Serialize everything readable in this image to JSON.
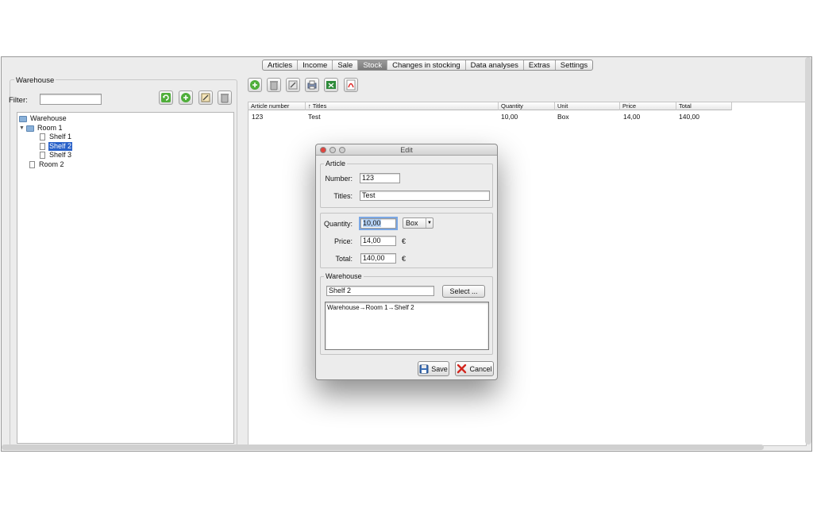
{
  "tabs": [
    {
      "label": "Articles",
      "active": false
    },
    {
      "label": "Income",
      "active": false
    },
    {
      "label": "Sale",
      "active": false
    },
    {
      "label": "Stock",
      "active": true
    },
    {
      "label": "Changes in stocking",
      "active": false
    },
    {
      "label": "Data analyses",
      "active": false
    },
    {
      "label": "Extras",
      "active": false
    },
    {
      "label": "Settings",
      "active": false
    }
  ],
  "left": {
    "group_title": "Warehouse",
    "filter_label": "Filter:",
    "filter_value": "",
    "toolbar_icons": [
      "refresh-icon",
      "add-icon",
      "edit-icon",
      "delete-icon"
    ],
    "tree": [
      {
        "label": "Warehouse",
        "type": "folder"
      },
      {
        "label": "Room 1",
        "type": "folder",
        "expanded": true
      },
      {
        "label": "Shelf 1",
        "type": "page"
      },
      {
        "label": "Shelf 2",
        "type": "page",
        "selected": true
      },
      {
        "label": "Shelf 3",
        "type": "page"
      },
      {
        "label": "Room 2",
        "type": "page"
      }
    ]
  },
  "right": {
    "toolbar_icons": [
      "add-icon",
      "delete-icon",
      "edit-icon",
      "print-icon",
      "export-excel-icon",
      "export-pdf-icon"
    ],
    "table": {
      "columns": [
        "Article number",
        "↑ Titles",
        "Quantity",
        "Unit",
        "Price",
        "Total"
      ],
      "rows": [
        [
          "123",
          "Test",
          "10,00",
          "Box",
          "14,00",
          "140,00"
        ]
      ]
    }
  },
  "dialog": {
    "title": "Edit",
    "article_group": "Article",
    "number_label": "Number:",
    "number_value": "123",
    "titles_label": "Titles:",
    "titles_value": "Test",
    "quantity_label": "Quantity:",
    "quantity_value": "10,00",
    "unit_value": "Box",
    "price_label": "Price:",
    "price_value": "14,00",
    "total_label": "Total:",
    "total_value": "140,00",
    "currency": "€",
    "warehouse_group": "Warehouse",
    "warehouse_value": "Shelf 2",
    "select_label": "Select ...",
    "path_text": "Warehouse→Room 1→Shelf 2",
    "save_label": "Save",
    "cancel_label": "Cancel"
  },
  "colors": {
    "selection": "#2a62c9",
    "active_tab": "#8a8a8a",
    "window_bg": "#ececec"
  }
}
